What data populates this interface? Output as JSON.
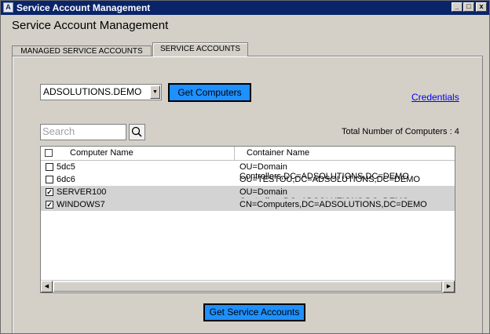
{
  "window": {
    "title": "Service Account Management",
    "app_icon_text": "A",
    "controls": {
      "minimize": "_",
      "maximize": "□",
      "close": "x"
    }
  },
  "header": {
    "title": "Service Account Management"
  },
  "tabs": [
    {
      "label": "MANAGED SERVICE ACCOUNTS",
      "active": false
    },
    {
      "label": "SERVICE ACCOUNTS",
      "active": true
    }
  ],
  "toolbar": {
    "domain_value": "ADSOLUTIONS.DEMO",
    "get_computers_label": "Get Computers",
    "credentials_label": "Credentials",
    "accent_color": "#1e90ff"
  },
  "search": {
    "placeholder": "Search",
    "icon": "search-icon"
  },
  "summary": {
    "total_label": "Total Number of Computers",
    "separator": ":",
    "total_count": "4"
  },
  "grid": {
    "columns": [
      "Computer Name",
      "Container Name"
    ],
    "rows": [
      {
        "checked": false,
        "name": "5dc5",
        "container": "OU=Domain Controllers,DC=ADSOLUTIONS,DC=DEMO"
      },
      {
        "checked": false,
        "name": "6dc6",
        "container": "OU=TESTOU,DC=ADSOLUTIONS,DC=DEMO"
      },
      {
        "checked": true,
        "name": "SERVER100",
        "container": "OU=Domain Controllers,DC=ADSOLUTIONS,DC=DEMO"
      },
      {
        "checked": true,
        "name": "WINDOWS7",
        "container": "CN=Computers,DC=ADSOLUTIONS,DC=DEMO"
      }
    ],
    "check_mark": "✓"
  },
  "footer": {
    "get_service_accounts_label": "Get Service Accounts"
  }
}
